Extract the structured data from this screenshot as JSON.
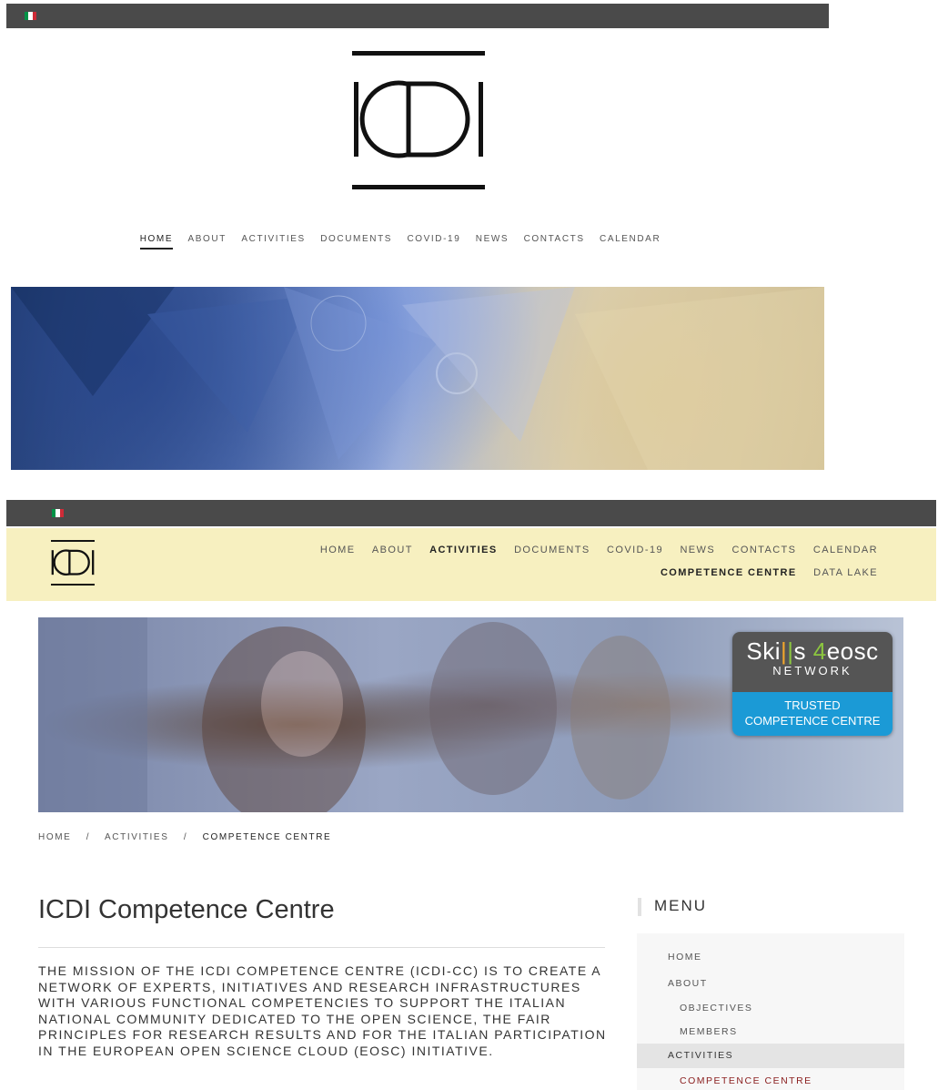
{
  "top": {
    "flag_colors": [
      "#009246",
      "#ffffff",
      "#ce2b37"
    ],
    "logo_icon": "icdi-logo-icon",
    "nav": [
      "HOME",
      "ABOUT",
      "ACTIVITIES",
      "DOCUMENTS",
      "COVID-19",
      "NEWS",
      "CONTACTS",
      "CALENDAR"
    ],
    "nav_active": "HOME"
  },
  "second": {
    "nav_row1": [
      "HOME",
      "ABOUT",
      "ACTIVITIES",
      "DOCUMENTS",
      "COVID-19",
      "NEWS",
      "CONTACTS",
      "CALENDAR"
    ],
    "nav_row2": [
      "COMPETENCE CENTRE",
      "DATA LAKE"
    ],
    "nav_active": [
      "ACTIVITIES",
      "COMPETENCE CENTRE"
    ],
    "badge": {
      "skills_a": "Ski",
      "skills_b": "s",
      "four": "4",
      "eosc": "eosc",
      "network": "NETWORK",
      "line1": "TRUSTED",
      "line2": "COMPETENCE CENTRE"
    },
    "breadcrumb": [
      "HOME",
      "ACTIVITIES",
      "COMPETENCE CENTRE"
    ],
    "breadcrumb_sep": "/",
    "title": "ICDI Competence Centre",
    "mission": "THE MISSION OF THE ICDI COMPETENCE CENTRE (ICDI-CC) IS TO CREATE A NETWORK OF EXPERTS, INITIATIVES AND RESEARCH INFRASTRUCTURES WITH VARIOUS FUNCTIONAL COMPETENCIES TO SUPPORT THE ITALIAN NATIONAL COMMUNITY DEDICATED TO THE OPEN SCIENCE, THE FAIR PRINCIPLES FOR RESEARCH RESULTS AND FOR THE ITALIAN PARTICIPATION IN THE EUROPEAN OPEN SCIENCE CLOUD (EOSC) INITIATIVE.",
    "menu": {
      "heading": "MENU",
      "items": [
        "HOME",
        "ABOUT",
        "OBJECTIVES",
        "MEMBERS",
        "ACTIVITIES",
        "COMPETENCE CENTRE"
      ]
    },
    "colors": {
      "header_bg": "#f7f0c0",
      "topbar": "#4a4a4a",
      "menu_active": "#8b2020",
      "badge_blue": "#1b9ad6"
    }
  }
}
